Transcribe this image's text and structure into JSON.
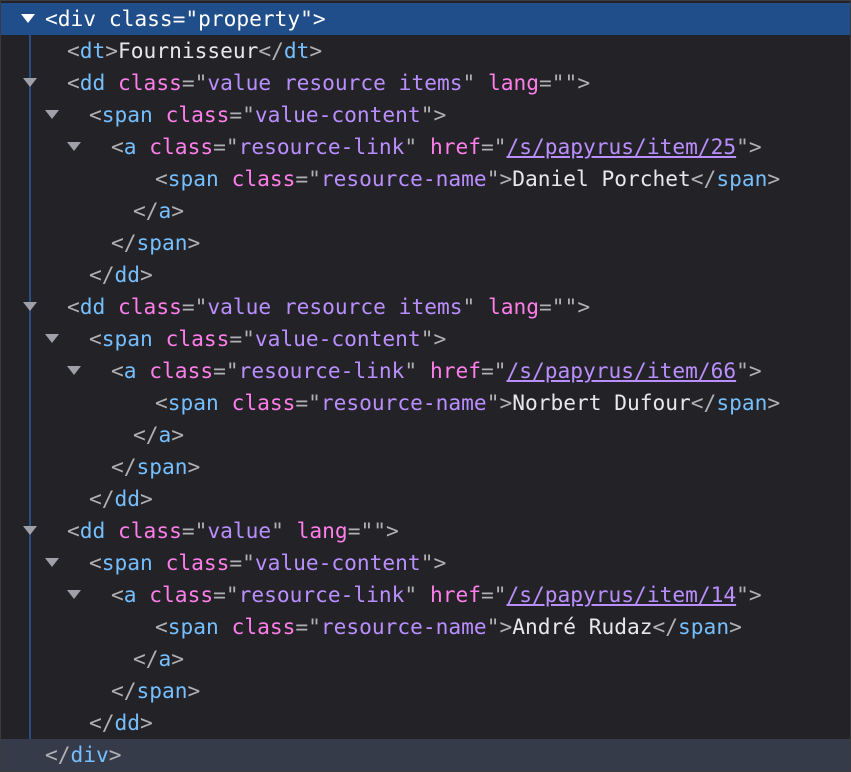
{
  "root_open": {
    "tag": "div",
    "attr": "class",
    "value": "property"
  },
  "root_close": {
    "tag": "div"
  },
  "dt": {
    "tag": "dt",
    "text": "Fournisseur"
  },
  "entries": [
    {
      "dd_attrs": [
        {
          "name": "class",
          "value": "value resource items"
        },
        {
          "name": "lang",
          "value": ""
        }
      ],
      "href": "/s/papyrus/item/25",
      "name": "Daniel Porchet"
    },
    {
      "dd_attrs": [
        {
          "name": "class",
          "value": "value resource items"
        },
        {
          "name": "lang",
          "value": ""
        }
      ],
      "href": "/s/papyrus/item/66",
      "name": "Norbert Dufour"
    },
    {
      "dd_attrs": [
        {
          "name": "class",
          "value": "value"
        },
        {
          "name": "lang",
          "value": ""
        }
      ],
      "href": "/s/papyrus/item/14",
      "name": "André Rudaz"
    }
  ],
  "labels": {
    "dd": "dd",
    "span": "span",
    "a": "a",
    "class_attr": "class",
    "href_attr": "href",
    "span_class": "value-content",
    "a_class": "resource-link",
    "name_class": "resource-name"
  }
}
